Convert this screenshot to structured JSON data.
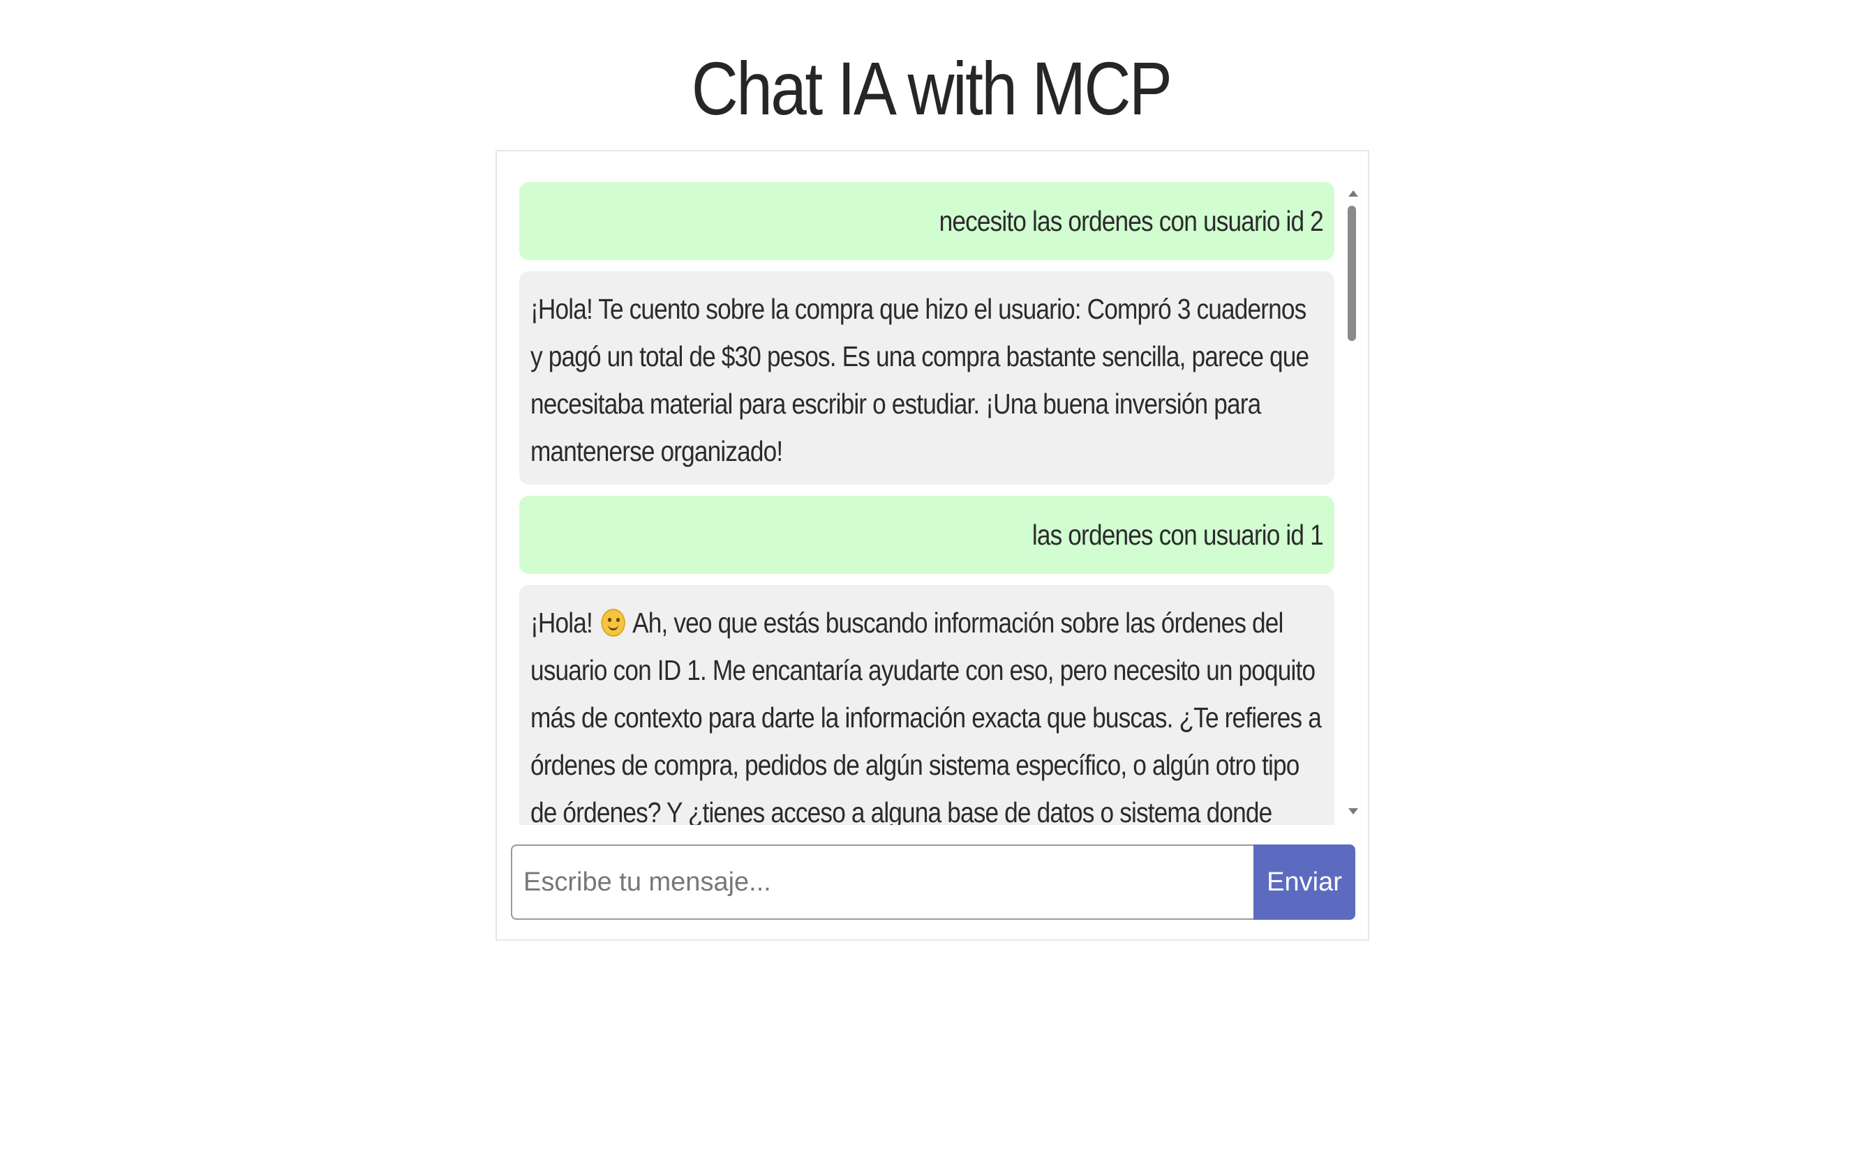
{
  "header": {
    "title": "Chat IA with MCP"
  },
  "messages": [
    {
      "role": "user",
      "text": "necesito las ordenes con usuario id 2"
    },
    {
      "role": "bot",
      "text": "¡Hola! Te cuento sobre la compra que hizo el usuario: Compró 3 cuadernos y pagó un total de $30 pesos. Es una compra bastante sencilla, parece que necesitaba material para escribir o estudiar. ¡Una buena inversión para mantenerse organizado!"
    },
    {
      "role": "user",
      "text": "las ordenes con usuario id 1"
    },
    {
      "role": "bot",
      "text_before_emoji": "¡Hola!",
      "emoji": "smiling-face-icon",
      "text_after_emoji": "Ah, veo que estás buscando información sobre las órdenes del usuario con ID 1. Me encantaría ayudarte con eso, pero necesito un poquito más de contexto para darte la información exacta que buscas. ¿Te refieres a órdenes de compra, pedidos de algún sistema específico, o algún otro tipo de órdenes? Y ¿tienes acceso a alguna base de datos o sistema donde"
    }
  ],
  "composer": {
    "placeholder": "Escribe tu mensaje...",
    "value": "",
    "send_label": "Enviar"
  },
  "colors": {
    "user_bubble": "#d1fdd1",
    "bot_bubble": "#f0f0f0",
    "send_button": "#5c6bc0"
  }
}
